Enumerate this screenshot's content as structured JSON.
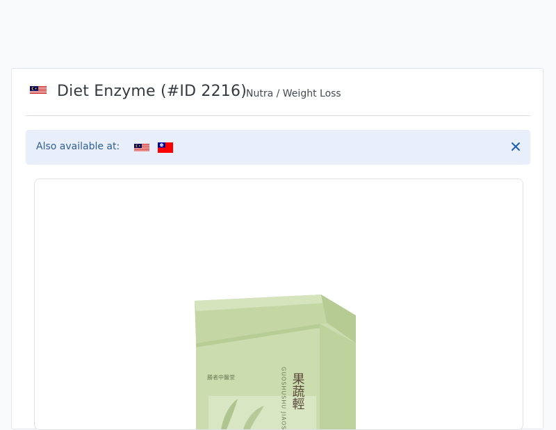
{
  "product": {
    "title": "Diet Enzyme (#ID 2216)",
    "category": "Nutra / Weight Loss",
    "country_flag": "malaysia-flag"
  },
  "alert": {
    "label": "Also available at:",
    "flags": [
      "malaysia-flag",
      "taiwan-flag"
    ],
    "close_icon": "close-icon"
  },
  "image": {
    "box_text": {
      "brand": "勝者中醫堂",
      "name_cn": "果蔬輕",
      "name_pinyin": "GUOSHUSHU JIAOSUFEN"
    }
  },
  "colors": {
    "background": "#f8f9fb",
    "alert_bg": "#e8effb",
    "alert_text": "#2f5e92",
    "box_green": "#cbdcae",
    "close_icon": "#1a5fb4"
  }
}
